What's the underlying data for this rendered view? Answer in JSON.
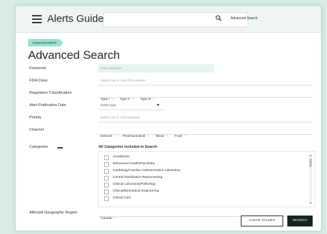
{
  "header": {
    "app_title": "Alerts Guide",
    "search_placeholder": "",
    "advanced_link": "Advanced Search"
  },
  "breadcrumb": {
    "label": "Advanced Search"
  },
  "page_title": "Advanced Search",
  "form": {
    "keywords": {
      "label": "Keywords",
      "placeholder": "Type keywords"
    },
    "fda_class": {
      "label": "FDA Class",
      "placeholder": "Select one or more FDA classes"
    },
    "regulatory": {
      "label": "Regulatory Classification",
      "chips": [
        "Type I",
        "Type II",
        "Type III"
      ]
    },
    "alert_date": {
      "label": "Alert Publication Date",
      "value": "Select type"
    },
    "priority": {
      "label": "Priority",
      "placeholder": "Select one or more priorities"
    },
    "channel": {
      "label": "Channel",
      "chips": [
        "Devices",
        "Pharmaceutical",
        "Blood",
        "Food"
      ]
    },
    "categories": {
      "label": "Categories",
      "heading": "All Categories included in Search",
      "items": [
        "Anesthesia",
        "Behavioral Health/Psychiatry",
        "Cardiology/Cardiac Catheterization Laboratory",
        "Central Sterilization Reprocessing",
        "Clinical Laboratory/Pathology",
        "Clinical/Biomedical Engineering",
        "Critical Care"
      ]
    },
    "geo_region": {
      "label": "Affected Geographic Region",
      "chips": [
        "Canada"
      ]
    }
  },
  "buttons": {
    "clear": "CLEAR VALUES",
    "search": "SEARCH"
  },
  "colors": {
    "accent": "#9ee0d2",
    "background": "#d7ece6",
    "dark": "#172524"
  },
  "chip_remove_glyph": "×"
}
